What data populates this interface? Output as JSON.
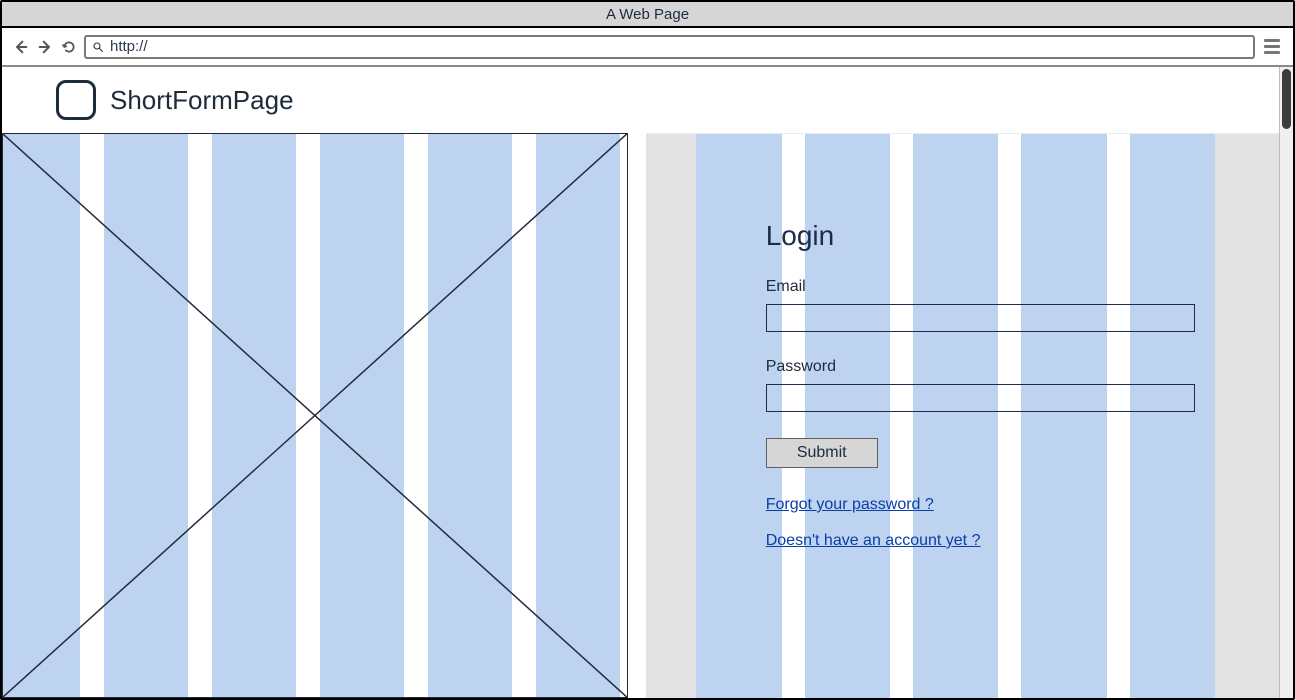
{
  "browser": {
    "window_title": "A Web Page",
    "address_prefix": "http://",
    "icons": {
      "back": "back-arrow-icon",
      "forward": "forward-arrow-icon",
      "reload": "reload-icon",
      "search": "search-icon",
      "menu": "menu-icon"
    }
  },
  "header": {
    "logo": "app-logo-icon",
    "title": "ShortFormPage"
  },
  "left_panel": {
    "kind": "image-placeholder"
  },
  "form": {
    "title": "Login",
    "fields": {
      "email": {
        "label": "Email",
        "value": ""
      },
      "password": {
        "label": "Password",
        "value": ""
      }
    },
    "submit_label": "Submit",
    "links": {
      "forgot": "Forgot your password ?",
      "signup": "Doesn't have an account yet ? "
    }
  },
  "colors": {
    "grid_column": "#bdd3ef",
    "page_gray": "#e3e3e3",
    "ink": "#1e2b3b",
    "link": "#0a3ea8"
  }
}
